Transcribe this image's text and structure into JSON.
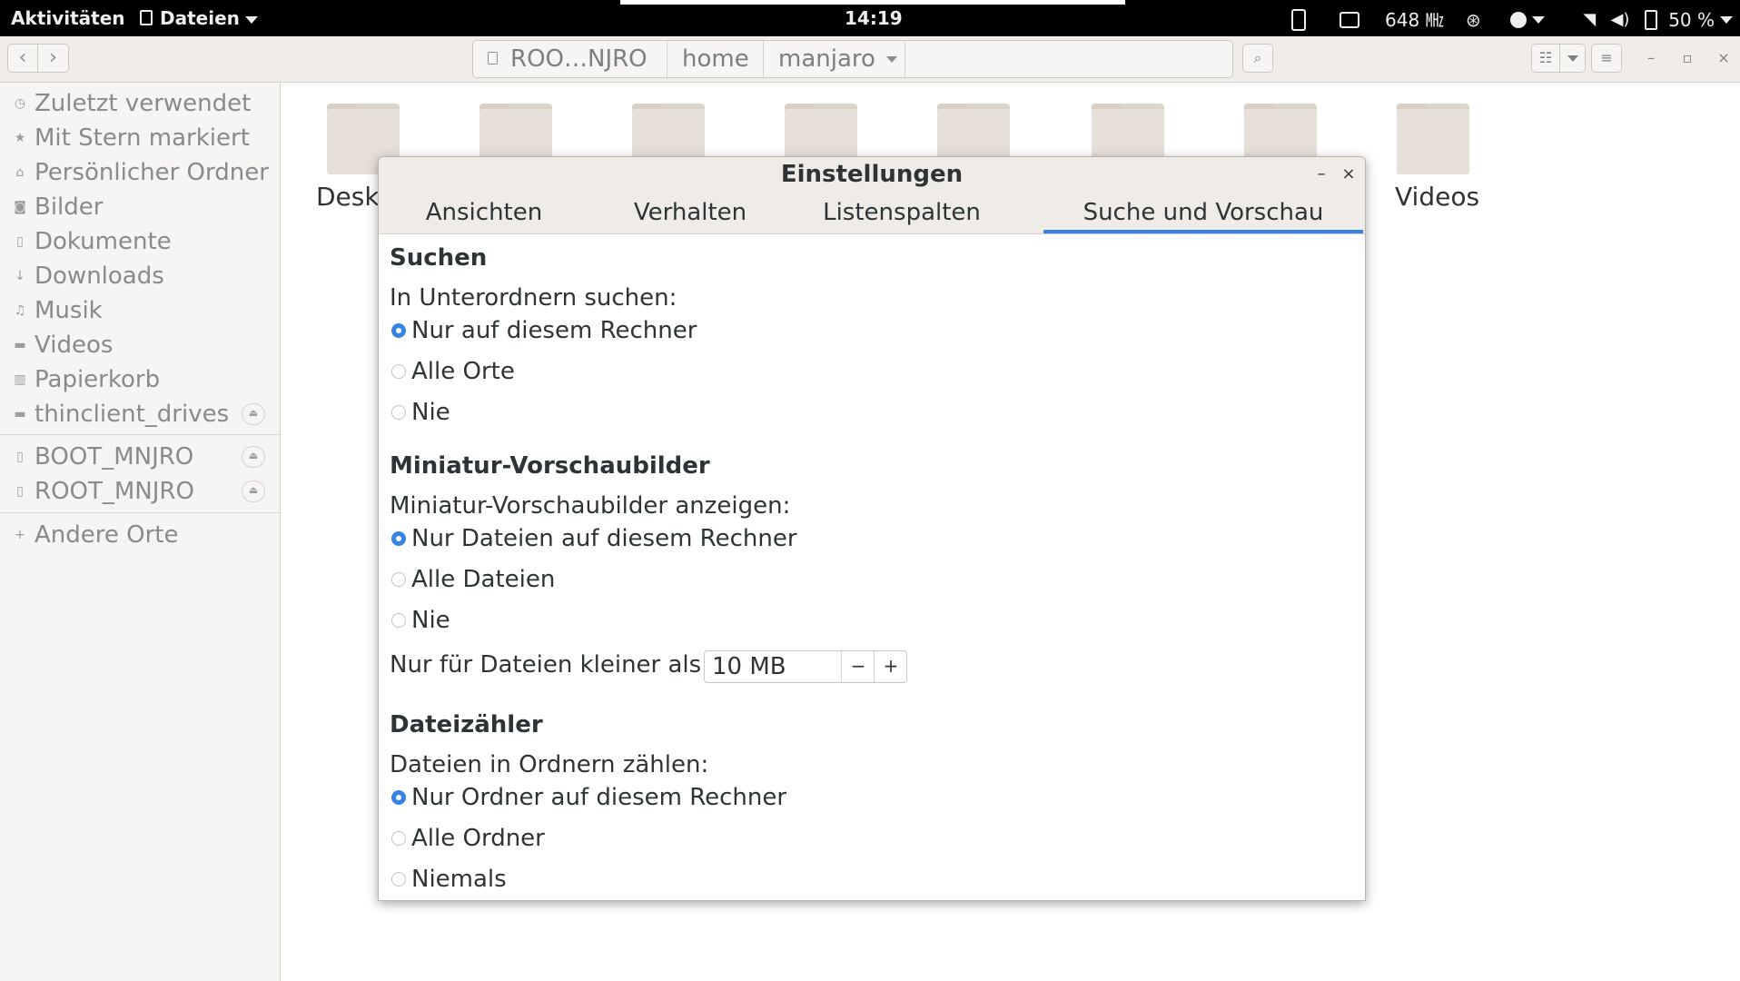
{
  "top_panel": {
    "activities": "Aktivitäten",
    "app_menu": "Dateien",
    "clock": "14:19",
    "cpu_freq": "648 ㎒",
    "battery": "50 %"
  },
  "headerbar": {
    "path": [
      "ROO…NJRO",
      "home",
      "manjaro"
    ]
  },
  "sidebar": {
    "places": [
      {
        "label": "Zuletzt verwendet",
        "icon": "clock-icon"
      },
      {
        "label": "Mit Stern markiert",
        "icon": "star-icon"
      },
      {
        "label": "Persönlicher Ordner",
        "icon": "home-icon"
      },
      {
        "label": "Bilder",
        "icon": "camera-icon"
      },
      {
        "label": "Dokumente",
        "icon": "document-icon"
      },
      {
        "label": "Downloads",
        "icon": "download-icon"
      },
      {
        "label": "Musik",
        "icon": "music-icon"
      },
      {
        "label": "Videos",
        "icon": "video-icon"
      },
      {
        "label": "Papierkorb",
        "icon": "trash-icon"
      },
      {
        "label": "thinclient_drives",
        "icon": "drive-icon"
      }
    ],
    "devices": [
      {
        "label": "BOOT_MNJRO",
        "icon": "drive-icon"
      },
      {
        "label": "ROOT_MNJRO",
        "icon": "drive-icon"
      }
    ],
    "other": "Andere Orte"
  },
  "content": {
    "folders": [
      "Desktop",
      "",
      "",
      "",
      "",
      "",
      "",
      "Videos"
    ]
  },
  "dialog": {
    "title": "Einstellungen",
    "tabs": [
      "Ansichten",
      "Verhalten",
      "Listenspalten",
      "Suche und Vorschau"
    ],
    "active_tab": "Suche und Vorschau",
    "search": {
      "heading": "Suchen",
      "prompt": "In Unterordnern suchen:",
      "options": [
        "Nur auf diesem Rechner",
        "Alle Orte",
        "Nie"
      ],
      "selected": 0
    },
    "thumbnails": {
      "heading": "Miniatur-Vorschaubilder",
      "prompt": "Miniatur-Vorschaubilder anzeigen:",
      "options": [
        "Nur Dateien auf diesem Rechner",
        "Alle Dateien",
        "Nie"
      ],
      "selected": 0,
      "size_label": "Nur für Dateien kleiner als:",
      "size_value": "10 MB"
    },
    "counter": {
      "heading": "Dateizähler",
      "prompt": "Dateien in Ordnern zählen:",
      "options": [
        "Nur Ordner auf diesem Rechner",
        "Alle Ordner",
        "Niemals"
      ],
      "selected": 0
    }
  },
  "colors": {
    "accent": "#3584e4",
    "top_panel": "#000000",
    "sidebar_bg": "#f6f5f4",
    "folder": "#e7e0d8"
  }
}
